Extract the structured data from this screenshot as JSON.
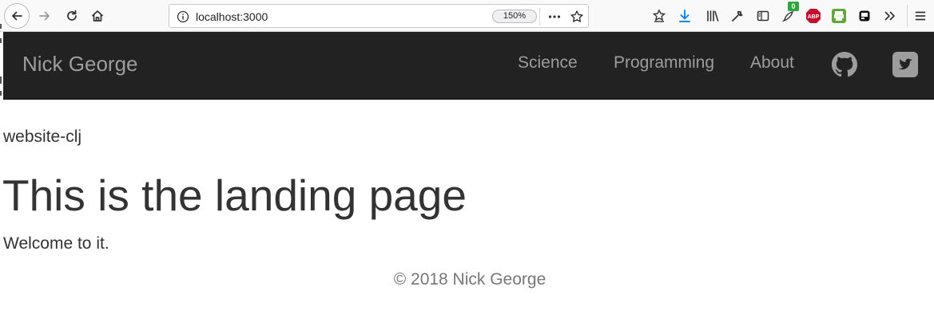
{
  "browser": {
    "url": "localhost:3000",
    "zoom": "150%",
    "extension_badge_count": "0",
    "abp_label": "ABP"
  },
  "navbar": {
    "brand": "Nick George",
    "links": [
      {
        "label": "Science"
      },
      {
        "label": "Programming"
      },
      {
        "label": "About"
      }
    ],
    "icons": [
      "github-icon",
      "twitter-icon"
    ]
  },
  "content": {
    "subtitle": "website-clj",
    "heading": "This is the landing page",
    "welcome": "Welcome to it."
  },
  "footer": {
    "text": "© 2018 Nick George"
  },
  "colors": {
    "navbar_bg": "#222222",
    "navbar_text": "#9d9d9d",
    "body_text": "#333333",
    "footer_text": "#777777"
  }
}
